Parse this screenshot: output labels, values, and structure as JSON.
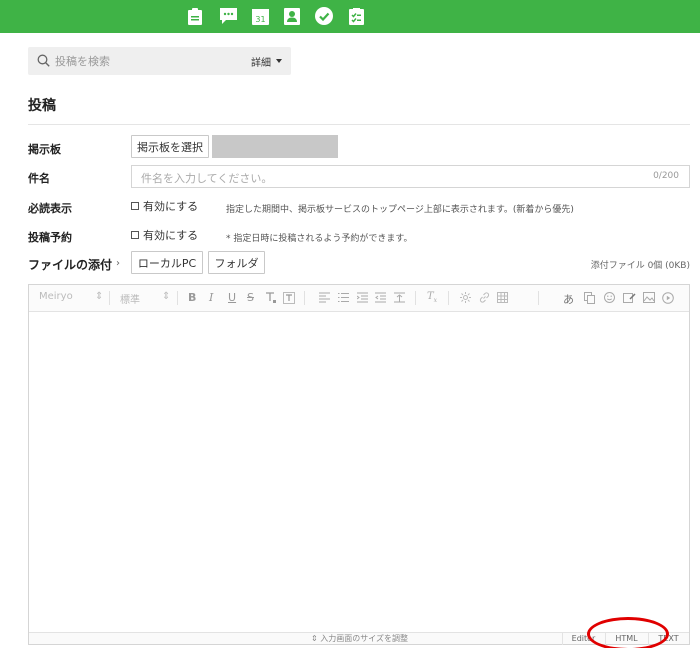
{
  "topbar": {
    "color": "#3fb346",
    "icons": [
      "note-icon",
      "chat-icon",
      "calendar-icon",
      "contacts-icon",
      "check-icon",
      "task-icon"
    ],
    "calendar_day": "31"
  },
  "search": {
    "placeholder": "投稿を検索",
    "detail_label": "詳細"
  },
  "page_title": "投稿",
  "form": {
    "board": {
      "label": "掲示板",
      "button": "掲示板を選択"
    },
    "subject": {
      "label": "件名",
      "placeholder": "件名を入力してください。",
      "counter": "0/200"
    },
    "must_read": {
      "label": "必読表示",
      "checkbox": "有効にする",
      "note": "指定した期間中、掲示板サービスのトップページ上部に表示されます。(新着から優先)"
    },
    "schedule": {
      "label": "投稿予約",
      "checkbox": "有効にする",
      "note": "* 指定日時に投稿されるよう予約ができます。"
    },
    "attachment": {
      "label": "ファイルの添付",
      "arrow": "›",
      "local_button": "ローカルPC",
      "folder_button": "フォルダ",
      "info": "添付ファイル 0個 (0KB)"
    }
  },
  "editor": {
    "font": "Meiryo",
    "size": "標準",
    "bold": "B",
    "italic": "I",
    "underline": "U",
    "strike": "S",
    "resize_label": "⇕ 入力画面のサイズを調整",
    "modes": [
      "Editor",
      "HTML",
      "TEXT"
    ]
  },
  "highlight_color": "#e00000"
}
